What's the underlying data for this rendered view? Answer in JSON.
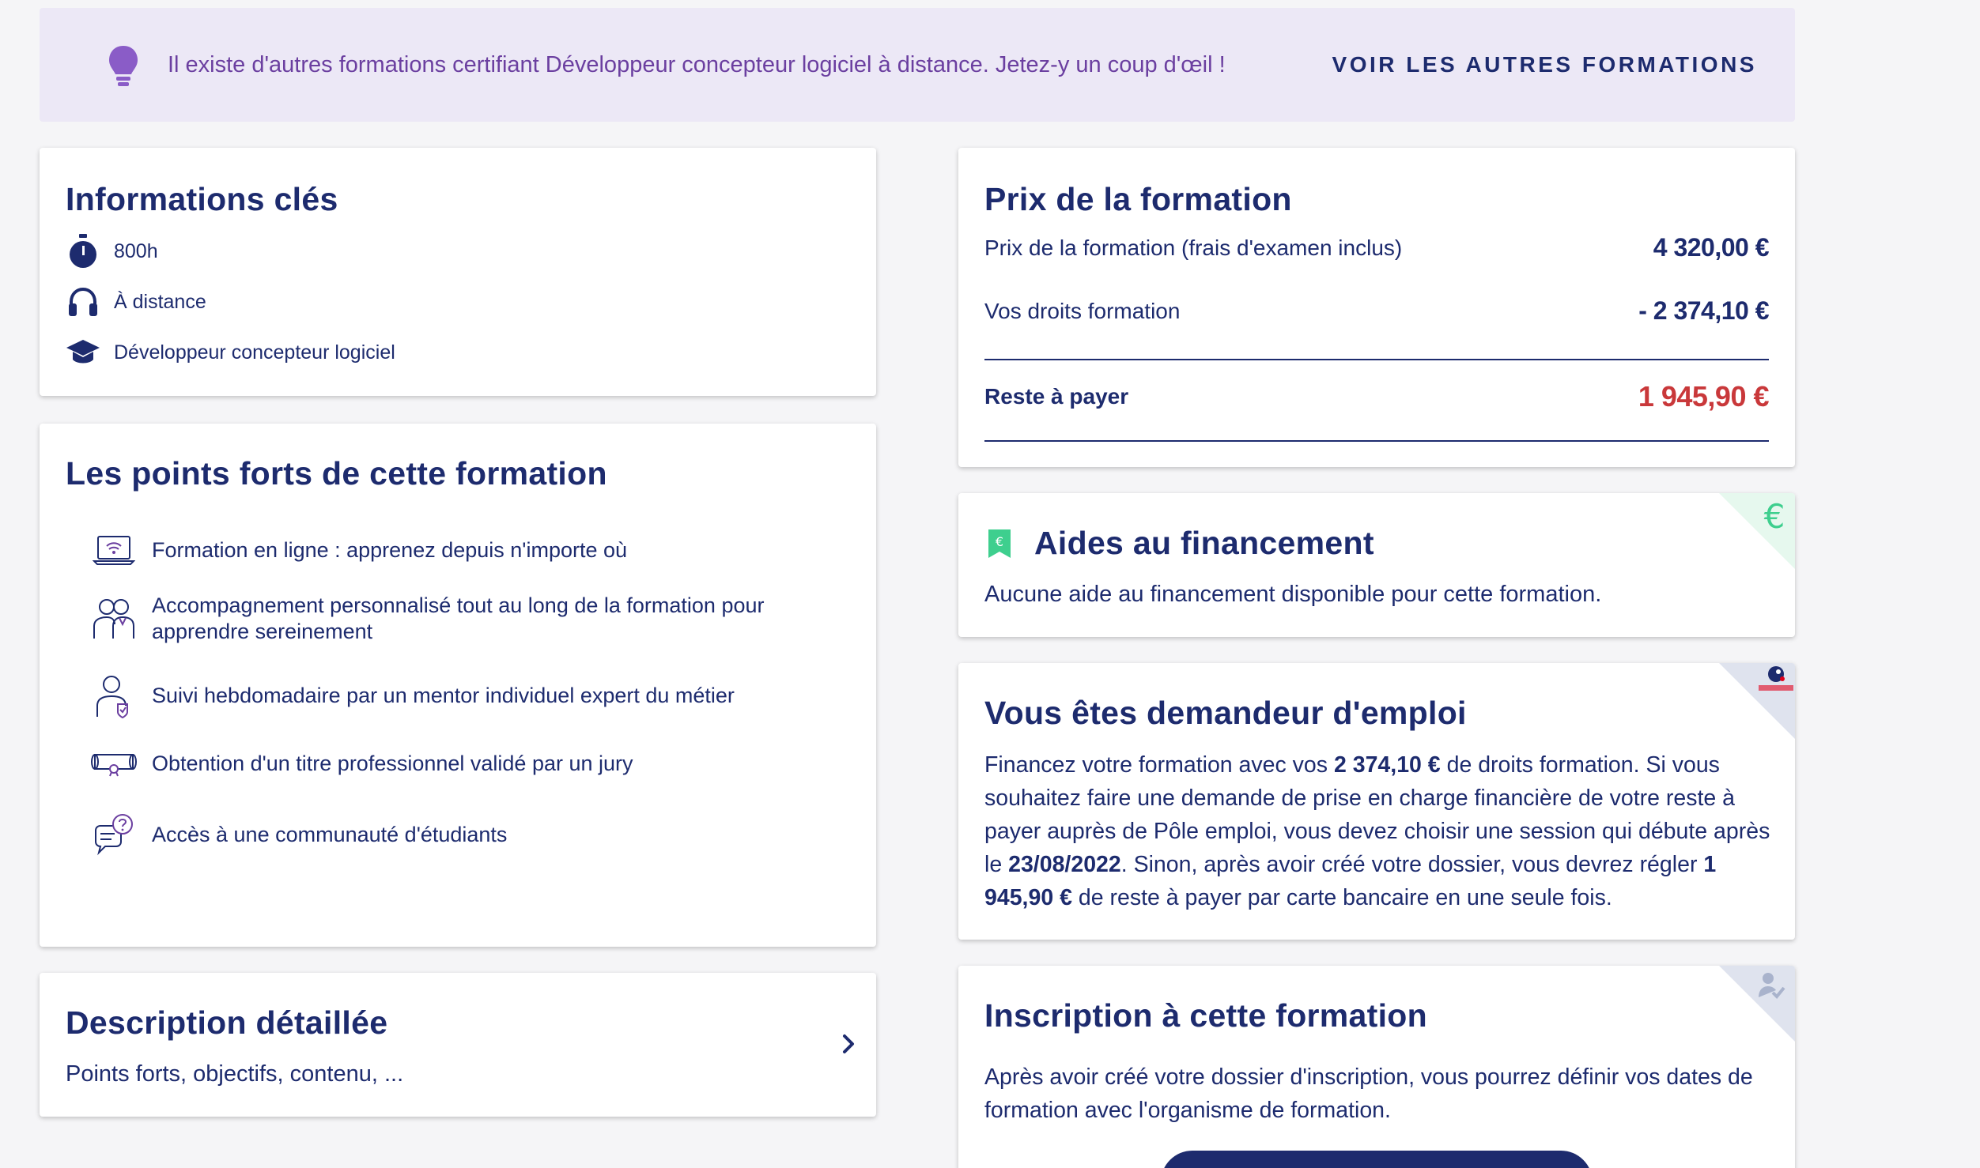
{
  "banner": {
    "message": "Il existe d'autres formations certifiant Développeur concepteur logiciel à distance. Jetez-y un coup d'œil !",
    "cta_label": "VOIR LES AUTRES FORMATIONS",
    "icon": "lightbulb-icon",
    "accent_color": "#8a5cc7"
  },
  "info": {
    "title": "Informations clés",
    "items": [
      {
        "icon": "stopwatch-icon",
        "label": "800h"
      },
      {
        "icon": "headphones-icon",
        "label": "À distance"
      },
      {
        "icon": "graduation-cap-icon",
        "label": "Développeur concepteur logiciel"
      }
    ]
  },
  "points": {
    "title": "Les points forts de cette formation",
    "items": [
      {
        "icon": "laptop-wifi-icon",
        "label": "Formation en ligne : apprenez depuis n'importe où"
      },
      {
        "icon": "people-icon",
        "label": "Accompagnement personnalisé tout au long de la formation pour apprendre sereinement"
      },
      {
        "icon": "mentor-icon",
        "label": "Suivi hebdomadaire par un mentor individuel expert du métier"
      },
      {
        "icon": "diploma-icon",
        "label": "Obtention d'un titre professionnel validé par un jury"
      },
      {
        "icon": "chat-question-icon",
        "label": "Accès à une communauté d'étudiants"
      }
    ]
  },
  "description": {
    "title": "Description détaillée",
    "subtitle": "Points forts, objectifs, contenu, ..."
  },
  "prix": {
    "title": "Prix de la formation",
    "rows": [
      {
        "label": "Prix de la formation (frais d'examen inclus)",
        "value": "4 320,00 €"
      },
      {
        "label": "Vos droits formation",
        "value": "- 2 374,10 €"
      }
    ],
    "total_label": "Reste à payer",
    "total_value": "1 945,90 €",
    "total_color": "#c9383a"
  },
  "aides": {
    "title": "Aides au financement",
    "subtitle": "Aucune aide au financement disponible pour cette formation.",
    "corner_icon": "euro-icon",
    "accent_color": "#3ecf8e"
  },
  "emploi": {
    "title": "Vous êtes demandeur d'emploi",
    "p1": "Financez votre formation avec vos ",
    "amount_rights": "2 374,10 €",
    "p2": " de droits formation. Si vous souhaitez faire une demande de prise en charge financière de votre reste à payer auprès de Pôle emploi, vous devez choisir une session qui débute après le ",
    "date": "23/08/2022",
    "p3": ". Sinon, après avoir créé votre dossier, vous devrez régler ",
    "amount_rest": "1 945,90 €",
    "p4": " de reste à payer par carte bancaire en une seule fois.",
    "corner_icon": "pole-emploi-logo"
  },
  "inscription": {
    "title": "Inscription à cette formation",
    "body": "Après avoir créé votre dossier d'inscription, vous pourrez définir vos dates de formation avec l'organisme de formation.",
    "corner_icon": "user-check-icon"
  }
}
